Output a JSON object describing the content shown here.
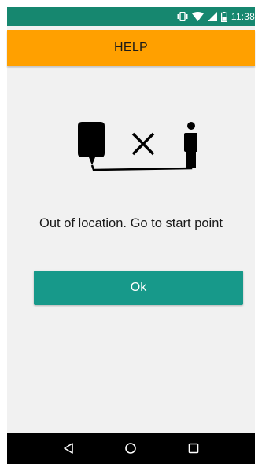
{
  "status_bar": {
    "time": "11:38",
    "icons": [
      "vibrate-icon",
      "wifi-icon",
      "signal-icon",
      "battery-icon"
    ],
    "bg_color": "#16876f"
  },
  "header": {
    "title": "HELP",
    "bg_color": "#ffa000"
  },
  "illustration": {
    "icons": [
      "speech-bubble-icon",
      "cross-icon",
      "person-icon"
    ]
  },
  "message": {
    "text": "Out of location. Go to start point"
  },
  "ok_button": {
    "label": "Ok",
    "bg_color": "#17998a"
  },
  "nav_bar": {
    "buttons": [
      "back-icon",
      "home-icon",
      "recents-icon"
    ]
  }
}
